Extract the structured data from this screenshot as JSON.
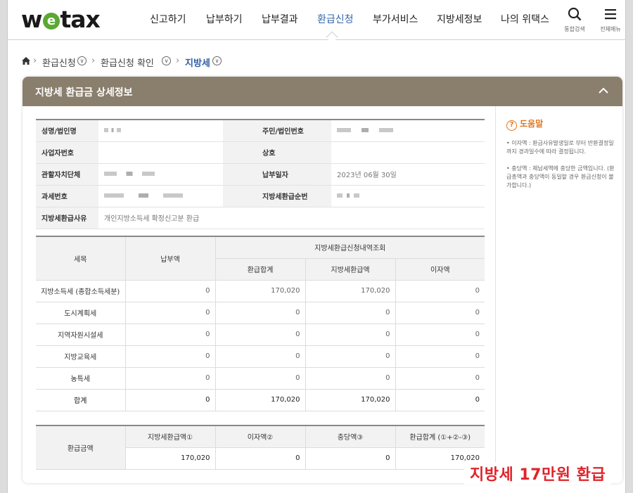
{
  "header": {
    "logo_pre": "w",
    "logo_e": "e",
    "logo_post": "tax",
    "nav": [
      "신고하기",
      "납부하기",
      "납부결과",
      "환급신청",
      "부가서비스",
      "지방세정보",
      "나의 위택스"
    ],
    "active_index": 3,
    "search_label": "통합검색",
    "menu_label": "전체메뉴"
  },
  "breadcrumb": [
    "환급신청",
    "환급신청 확인",
    "지방세"
  ],
  "panel": {
    "title": "지방세 환급금 상세정보",
    "info": {
      "name_label": "성명/법인명",
      "rrn_label": "주민/법인번호",
      "bizno_label": "사업자번호",
      "trade_label": "상호",
      "org_label": "관할자치단체",
      "paydate_label": "납부일자",
      "paydate_value": "2023년 06월 30일",
      "taxno_label": "과세번호",
      "refundno_label": "지방세환급순번",
      "reason_label": "지방세환급사유",
      "reason_value": "개인지방소득세 확정신고분 환급"
    },
    "detail": {
      "col_item": "세목",
      "col_paid": "납부액",
      "col_group": "지방세환급신청내역조회",
      "col_total": "환급합계",
      "col_refund": "지방세환급액",
      "col_interest": "이자액",
      "rows": [
        {
          "item": "지방소득세 (종합소득세분)",
          "paid": "0",
          "total": "170,020",
          "refund": "170,020",
          "interest": "0"
        },
        {
          "item": "도시계획세",
          "paid": "0",
          "total": "0",
          "refund": "0",
          "interest": "0"
        },
        {
          "item": "지역자원시설세",
          "paid": "0",
          "total": "0",
          "refund": "0",
          "interest": "0"
        },
        {
          "item": "지방교육세",
          "paid": "0",
          "total": "0",
          "refund": "0",
          "interest": "0"
        },
        {
          "item": "농특세",
          "paid": "0",
          "total": "0",
          "refund": "0",
          "interest": "0"
        },
        {
          "item": "합계",
          "paid": "0",
          "total": "170,020",
          "refund": "170,020",
          "interest": "0"
        }
      ]
    },
    "summary": {
      "label": "환급금액",
      "h1": "지방세환급액①",
      "h2": "이자액②",
      "h3": "충당액③",
      "h4": "환급합계 (①+②-③)",
      "v1": "170,020",
      "v2": "0",
      "v3": "0",
      "v4": "170,020"
    }
  },
  "help": {
    "title": "도움말",
    "p1": "• 이자액 : 환급사유발생일로 부터 반환결정일까지 경과일수에 따라 결정됩니다.",
    "p2": "• 충당액 : 체납세액에 충당한 금액입니다. (환급총액과 충당액이 동일할 경우 환급신청이 불가합니다.)"
  },
  "caption": "지방세 17만원 환급",
  "colors": {
    "active_nav": "#3366aa",
    "panel_header": "#8a7e6d",
    "help_accent": "#e0741c",
    "caption": "#e0232b"
  }
}
